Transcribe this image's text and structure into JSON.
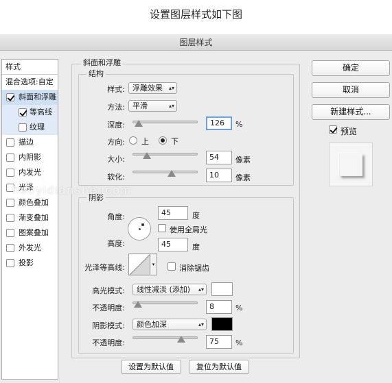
{
  "caption": "设置图层样式如下图",
  "window_title": "图层样式",
  "sidebar": {
    "header": "样式",
    "blend_options": "混合选项:自定",
    "items": [
      {
        "label": "斜面和浮雕",
        "checked": true
      },
      {
        "label": "等高线",
        "checked": true
      },
      {
        "label": "纹理",
        "checked": false
      },
      {
        "label": "描边",
        "checked": false
      },
      {
        "label": "内阴影",
        "checked": false
      },
      {
        "label": "内发光",
        "checked": false
      },
      {
        "label": "光泽",
        "checked": false
      },
      {
        "label": "颜色叠加",
        "checked": false
      },
      {
        "label": "渐变叠加",
        "checked": false
      },
      {
        "label": "图案叠加",
        "checked": false
      },
      {
        "label": "外发光",
        "checked": false
      },
      {
        "label": "投影",
        "checked": false
      }
    ]
  },
  "bevel": {
    "section_title": "斜面和浮雕",
    "structure": {
      "title": "结构",
      "style_label": "样式:",
      "style_value": "浮雕效果",
      "method_label": "方法:",
      "method_value": "平滑",
      "depth_label": "深度:",
      "depth_value": "126",
      "depth_unit": "%",
      "depth_slider_fraction": 0.09,
      "direction_label": "方向:",
      "direction_up": "上",
      "direction_down": "下",
      "direction_selected": "下",
      "size_label": "大小:",
      "size_value": "54",
      "size_unit": "像素",
      "size_slider_fraction": 0.22,
      "soften_label": "软化:",
      "soften_value": "10",
      "soften_unit": "像素",
      "soften_slider_fraction": 0.6
    },
    "shading": {
      "title": "阴影",
      "angle_label": "角度:",
      "angle_value": "45",
      "angle_unit": "度",
      "global_light_label": "使用全局光",
      "global_light_checked": false,
      "altitude_label": "高度:",
      "altitude_value": "45",
      "altitude_unit": "度",
      "gloss_contour_label": "光泽等高线:",
      "anti_alias_label": "消除锯齿",
      "anti_alias_checked": false,
      "highlight_mode_label": "高光模式:",
      "highlight_mode_value": "线性减淡 (添加)",
      "highlight_color": "#ffffff",
      "highlight_opacity_label": "不透明度:",
      "highlight_opacity_value": "8",
      "highlight_opacity_unit": "%",
      "highlight_opacity_fraction": 0.08,
      "shadow_mode_label": "阴影模式:",
      "shadow_mode_value": "颜色加深",
      "shadow_color": "#000000",
      "shadow_opacity_label": "不透明度:",
      "shadow_opacity_value": "75",
      "shadow_opacity_unit": "%",
      "shadow_opacity_fraction": 0.75
    },
    "set_default_label": "设置为默认值",
    "reset_default_label": "复位为默认值"
  },
  "actions": {
    "ok_label": "确定",
    "cancel_label": "取消",
    "new_style_label": "新建样式...",
    "preview_label": "预览",
    "preview_checked": true
  },
  "watermark": "haoyidianshejicom"
}
